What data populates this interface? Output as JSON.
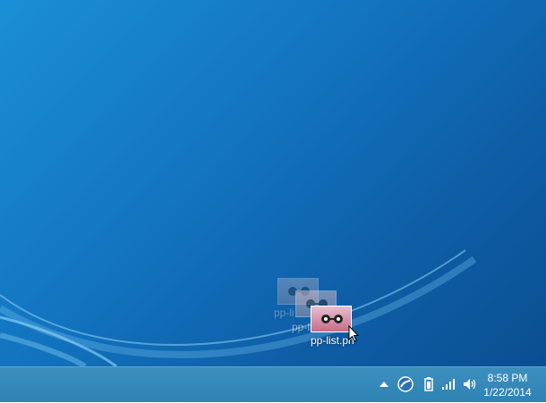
{
  "desktop": {
    "background_color": "#1478c4",
    "drag_items": [
      {
        "label": "pp-li",
        "icon": "image-file-icon"
      },
      {
        "label": "pp-li",
        "icon": "image-file-icon"
      },
      {
        "label": "pp-list.pn",
        "icon": "image-file-icon"
      }
    ]
  },
  "taskbar": {
    "tray_icons": [
      "chevron-up-icon",
      "app-tray-icon",
      "battery-icon",
      "signal-bars-icon",
      "volume-icon"
    ],
    "clock": {
      "time": "8:58 PM",
      "date": "1/22/2014"
    }
  }
}
